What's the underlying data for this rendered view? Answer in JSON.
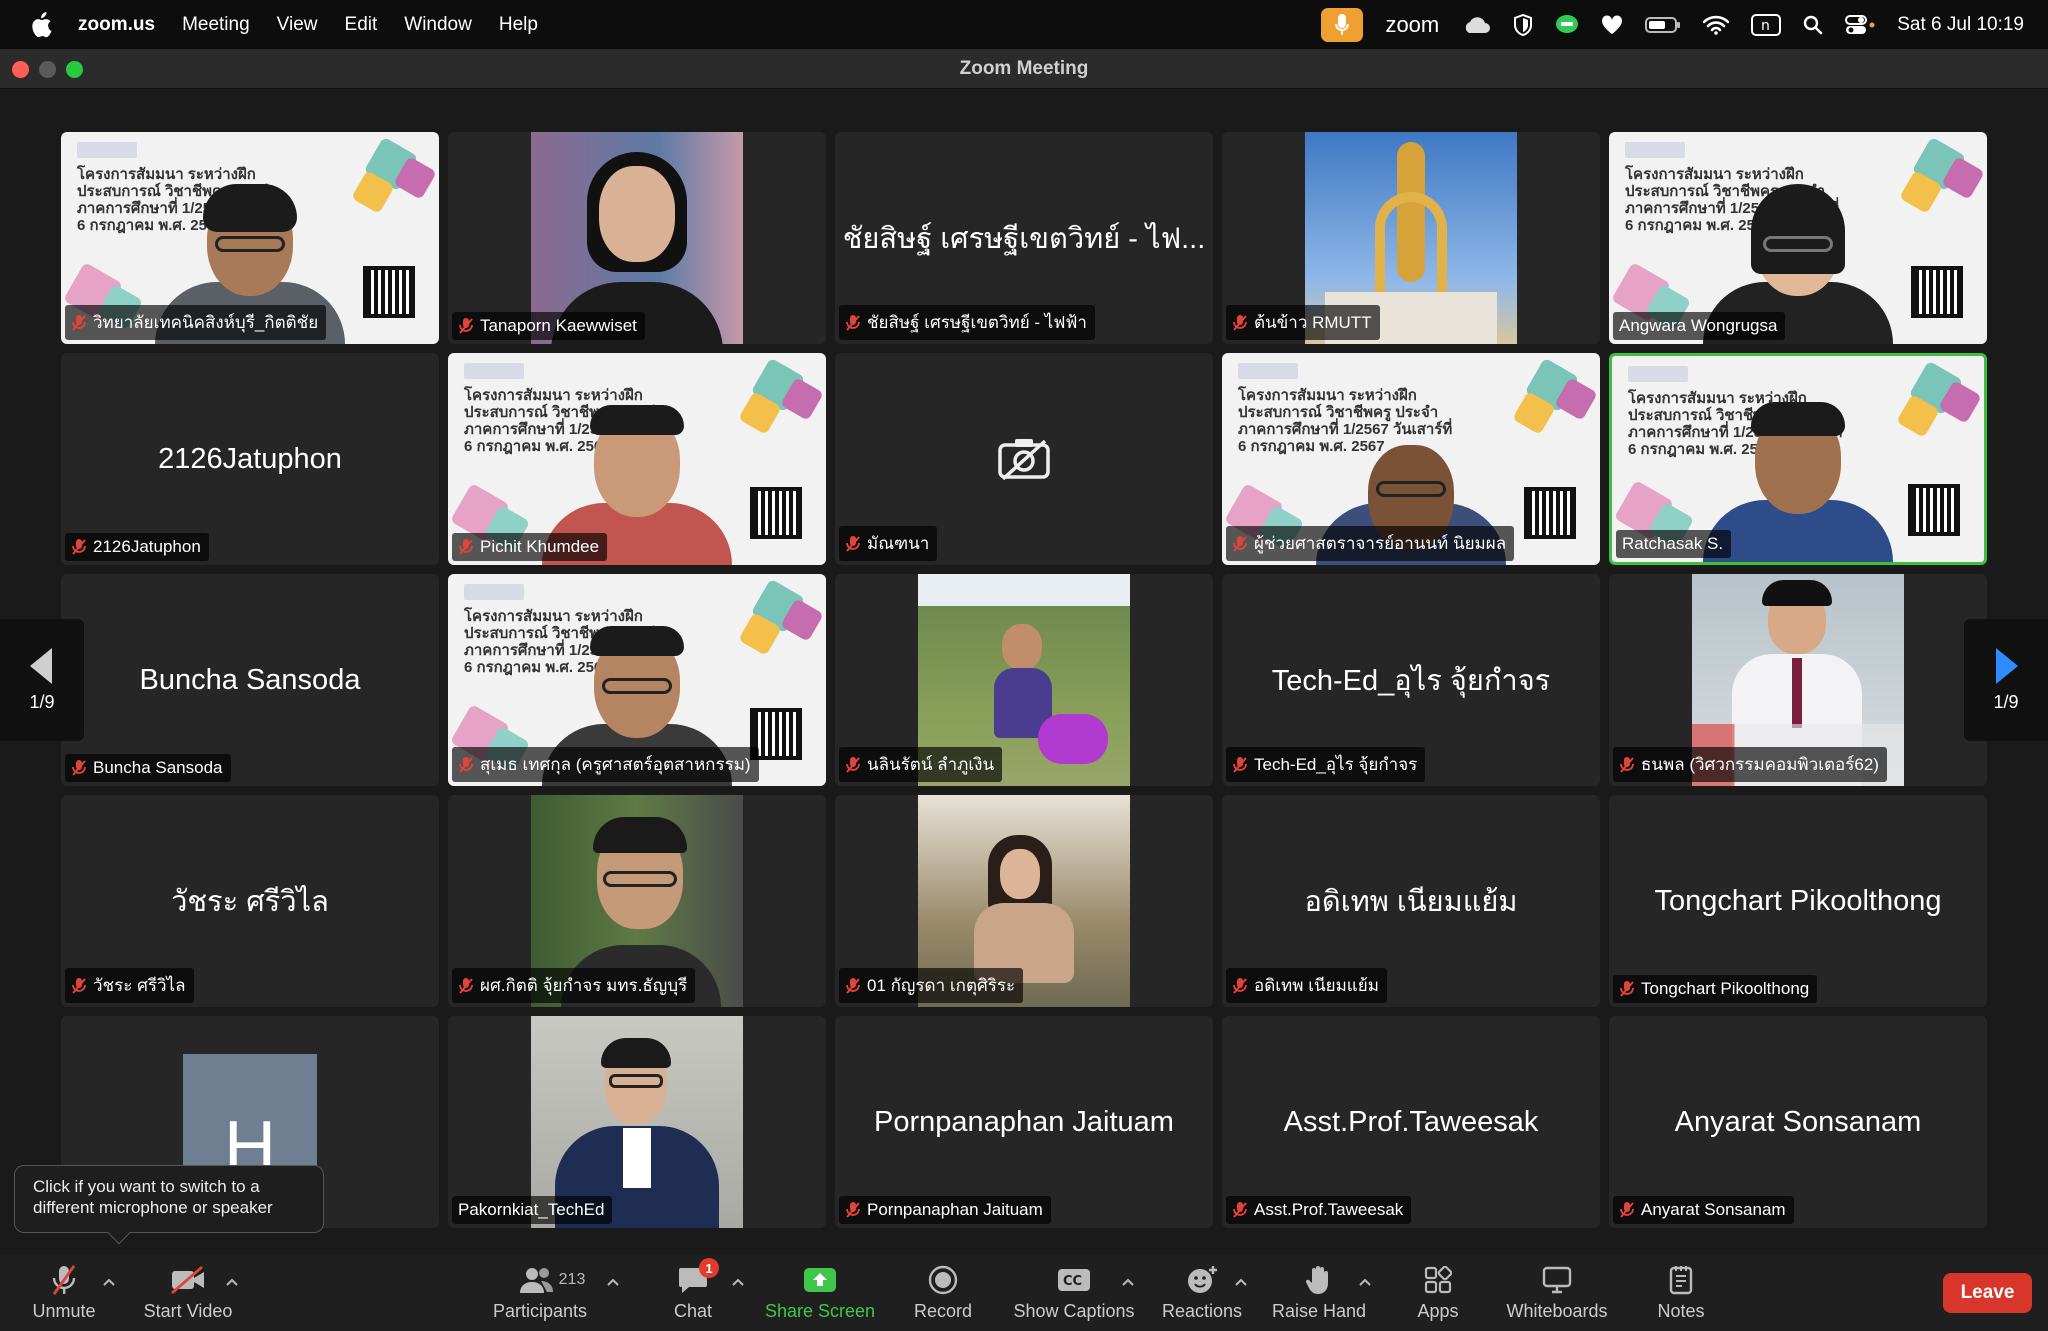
{
  "menubar": {
    "app": "zoom.us",
    "menus": [
      "Meeting",
      "View",
      "Edit",
      "Window",
      "Help"
    ],
    "zoom_label": "zoom",
    "datetime": "Sat 6 Jul  10:19"
  },
  "window": {
    "title": "Zoom Meeting"
  },
  "tiles": [
    {
      "label": "วิทยาลัยเทคนิคสิงห์บุรี_กิตติชัย"
    },
    {
      "label": "Tanaporn Kaewwiset"
    },
    {
      "label": "ชัยสิษฐ์ เศรษฐีเขตวิทย์ - ไฟฟ้า",
      "center": "ชัยสิษฐ์ เศรษฐีเขตวิทย์ - ไฟ..."
    },
    {
      "label": "ต้นข้าว RMUTT"
    },
    {
      "label": "Angwara Wongrugsa"
    },
    {
      "label": "2126Jatuphon",
      "center": "2126Jatuphon"
    },
    {
      "label": "Pichit Khumdee"
    },
    {
      "label": "มัณฑนา"
    },
    {
      "label": "ผู้ช่วยศาสตราจารย์อานนท์ นิยมผล"
    },
    {
      "label": "Ratchasak S."
    },
    {
      "label": "Buncha Sansoda",
      "center": "Buncha Sansoda"
    },
    {
      "label": "สุเมธ เทศกุล (ครูศาสตร์อุตสาหกรรม)"
    },
    {
      "label": "นลินรัตน์ ลำภูเงิน"
    },
    {
      "label": "Tech-Ed_อุไร จุ้ยกำจร",
      "center": "Tech-Ed_อุไร จุ้ยกำจร"
    },
    {
      "label": "ธนพล (วิศวกรรมคอมพิวเตอร์62)"
    },
    {
      "label": "วัชระ ศรีวิไล",
      "center": "วัชระ ศรีวิไล"
    },
    {
      "label": "ผศ.กิตติ จุ้ยกำจร มทร.ธัญบุรี"
    },
    {
      "label": "01 กัญรดา เกตุศิริระ"
    },
    {
      "label": "อดิเทพ เนียมแย้ม",
      "center": "อดิเทพ เนียมแย้ม"
    },
    {
      "label": "Tongchart Pikoolthong",
      "center": "Tongchart Pikoolthong"
    },
    {
      "label": "",
      "avatar": "H"
    },
    {
      "label": "Pakornkiat_TechEd"
    },
    {
      "label": "Pornpanaphan Jaituam",
      "center": "Pornpanaphan Jaituam"
    },
    {
      "label": "Asst.Prof.Taweesak",
      "center": "Asst.Prof.Taweesak"
    },
    {
      "label": "Anyarat Sonsanam",
      "center": "Anyarat Sonsanam"
    }
  ],
  "slide_text": "โครงการสัมมนา ระหว่างฝึกประสบการณ์ วิชาชีพครู ประจำภาคการศึกษาที่ 1/2567 วันเสาร์ที่ 6 กรกฎาคม พ.ศ. 2567",
  "pager": {
    "left": "1/9",
    "right": "1/9"
  },
  "tooltip": "Click if you want to switch to a different microphone or speaker",
  "toolbar": {
    "unmute": "Unmute",
    "start_video": "Start Video",
    "participants": "Participants",
    "participant_count": "213",
    "chat": "Chat",
    "chat_badge": "1",
    "share_screen": "Share Screen",
    "record": "Record",
    "show_captions": "Show Captions",
    "reactions": "Reactions",
    "raise_hand": "Raise Hand",
    "apps": "Apps",
    "whiteboards": "Whiteboards",
    "notes": "Notes",
    "leave": "Leave"
  },
  "colors": {
    "accent_green": "#3ec74a",
    "leave_red": "#d9362b",
    "active_border": "#3dbf3d",
    "mic_muted": "#e0443a"
  }
}
